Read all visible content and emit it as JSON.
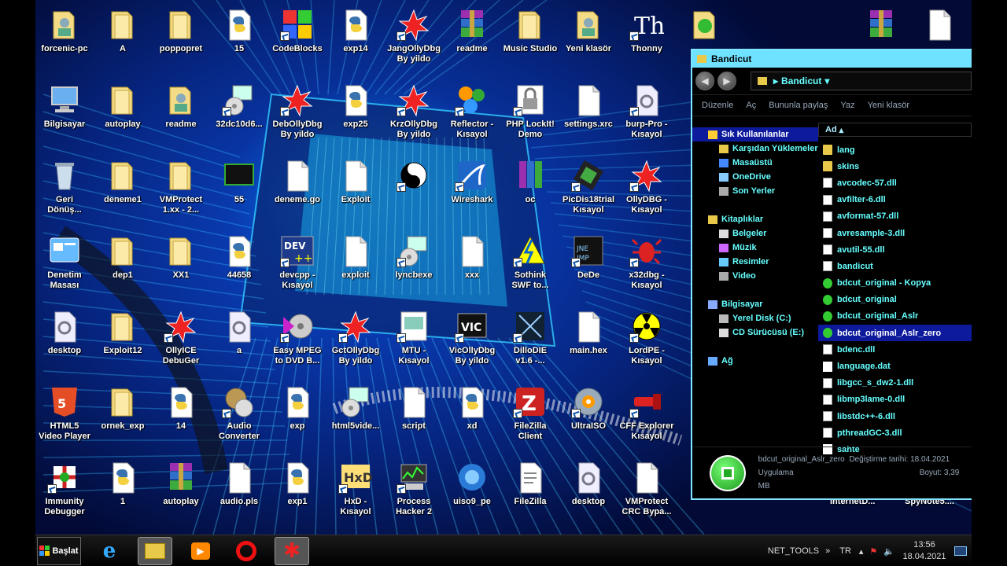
{
  "desktop": {
    "icons": [
      {
        "label": "forcenic-pc",
        "type": "user-folder",
        "col": 0,
        "row": 0,
        "shortcut": false
      },
      {
        "label": "A",
        "type": "folder",
        "col": 1,
        "row": 0,
        "shortcut": false
      },
      {
        "label": "poppopret",
        "type": "folder",
        "col": 2,
        "row": 0,
        "shortcut": false
      },
      {
        "label": "15",
        "type": "python",
        "col": 3,
        "row": 0,
        "shortcut": false
      },
      {
        "label": "CodeBlocks",
        "type": "codeblocks",
        "col": 4,
        "row": 0,
        "shortcut": true
      },
      {
        "label": "exp14",
        "type": "python",
        "col": 5,
        "row": 0,
        "shortcut": false
      },
      {
        "label": "JangOllyDbg\nBy yildo",
        "type": "olly",
        "col": 6,
        "row": 0,
        "shortcut": true
      },
      {
        "label": "readme",
        "type": "winrar",
        "col": 7,
        "row": 0,
        "shortcut": false
      },
      {
        "label": "Music Studio",
        "type": "folder",
        "col": 8,
        "row": 0,
        "shortcut": false
      },
      {
        "label": "Yeni klasör",
        "type": "user-folder",
        "col": 9,
        "row": 0,
        "shortcut": false
      },
      {
        "label": "Thonny",
        "type": "thonny",
        "col": 10,
        "row": 0,
        "shortcut": true
      },
      {
        "label": "",
        "type": "folder-green",
        "col": 11,
        "row": 0,
        "shortcut": false
      },
      {
        "label": "Bilgisayar",
        "type": "computer",
        "col": 0,
        "row": 1,
        "shortcut": false
      },
      {
        "label": "autoplay",
        "type": "folder",
        "col": 1,
        "row": 1,
        "shortcut": false
      },
      {
        "label": "readme",
        "type": "user-folder",
        "col": 2,
        "row": 1,
        "shortcut": false
      },
      {
        "label": "32dc10d6...",
        "type": "installer",
        "col": 3,
        "row": 1,
        "shortcut": true
      },
      {
        "label": "DebOllyDbg\nBy yildo",
        "type": "olly",
        "col": 4,
        "row": 1,
        "shortcut": true
      },
      {
        "label": "exp25",
        "type": "python",
        "col": 5,
        "row": 1,
        "shortcut": false
      },
      {
        "label": "KrzOllyDbg\nBy yildo",
        "type": "olly",
        "col": 6,
        "row": 1,
        "shortcut": true
      },
      {
        "label": "Reflector -\nKısayol",
        "type": "reflector",
        "col": 7,
        "row": 1,
        "shortcut": true
      },
      {
        "label": "PHP LockIt!\nDemo",
        "type": "lock",
        "col": 8,
        "row": 1,
        "shortcut": true
      },
      {
        "label": "settings.xrc",
        "type": "blank",
        "col": 9,
        "row": 1,
        "shortcut": false
      },
      {
        "label": "burp-Pro -\nKısayol",
        "type": "gear-doc",
        "col": 10,
        "row": 1,
        "shortcut": true
      },
      {
        "label": "Geri\nDönüş...",
        "type": "recycle",
        "col": 0,
        "row": 2,
        "shortcut": false
      },
      {
        "label": "deneme1",
        "type": "folder",
        "col": 1,
        "row": 2,
        "shortcut": false
      },
      {
        "label": "VMProtect\n1.xx - 2...",
        "type": "folder",
        "col": 2,
        "row": 2,
        "shortcut": false
      },
      {
        "label": "55",
        "type": "terminal",
        "col": 3,
        "row": 2,
        "shortcut": false
      },
      {
        "label": "deneme.go",
        "type": "blank",
        "col": 4,
        "row": 2,
        "shortcut": false
      },
      {
        "label": "Exploit",
        "type": "blank",
        "col": 5,
        "row": 2,
        "shortcut": false
      },
      {
        "label": "",
        "type": "yinyang",
        "col": 6,
        "row": 2,
        "shortcut": true
      },
      {
        "label": "Wireshark",
        "type": "wireshark",
        "col": 7,
        "row": 2,
        "shortcut": true
      },
      {
        "label": "oc",
        "type": "winrar-books",
        "col": 8,
        "row": 2,
        "shortcut": false
      },
      {
        "label": "PicDis18trial\nKısayol",
        "type": "chip",
        "col": 9,
        "row": 2,
        "shortcut": true
      },
      {
        "label": "OllyDBG -\nKısayol",
        "type": "olly",
        "col": 10,
        "row": 2,
        "shortcut": true
      },
      {
        "label": "Denetim\nMasası",
        "type": "control",
        "col": 0,
        "row": 3,
        "shortcut": false
      },
      {
        "label": "dep1",
        "type": "folder",
        "col": 1,
        "row": 3,
        "shortcut": false
      },
      {
        "label": "XX1",
        "type": "folder",
        "col": 2,
        "row": 3,
        "shortcut": false
      },
      {
        "label": "44658",
        "type": "python",
        "col": 3,
        "row": 3,
        "shortcut": false
      },
      {
        "label": "devcpp -\nKısayol",
        "type": "dev",
        "col": 4,
        "row": 3,
        "shortcut": true
      },
      {
        "label": "exploit",
        "type": "blank",
        "col": 5,
        "row": 3,
        "shortcut": false
      },
      {
        "label": "lyncbexe",
        "type": "installer",
        "col": 6,
        "row": 3,
        "shortcut": true
      },
      {
        "label": "xxx",
        "type": "blank",
        "col": 7,
        "row": 3,
        "shortcut": false
      },
      {
        "label": "Sothink\nSWF to...",
        "type": "sothink",
        "col": 8,
        "row": 3,
        "shortcut": true
      },
      {
        "label": "DeDe",
        "type": "dede",
        "col": 9,
        "row": 3,
        "shortcut": true
      },
      {
        "label": "x32dbg -\nKısayol",
        "type": "bug",
        "col": 10,
        "row": 3,
        "shortcut": true
      },
      {
        "label": "desktop",
        "type": "gear-doc",
        "col": 0,
        "row": 4,
        "shortcut": false
      },
      {
        "label": "Exploit12",
        "type": "folder",
        "col": 1,
        "row": 4,
        "shortcut": false
      },
      {
        "label": "OllyICE\nDebuGer",
        "type": "olly",
        "col": 2,
        "row": 4,
        "shortcut": true
      },
      {
        "label": "a",
        "type": "gear-doc",
        "col": 3,
        "row": 4,
        "shortcut": false
      },
      {
        "label": "Easy MPEG\nto DVD B...",
        "type": "disc",
        "col": 4,
        "row": 4,
        "shortcut": true
      },
      {
        "label": "GctOllyDbg\nBy yildo",
        "type": "olly",
        "col": 5,
        "row": 4,
        "shortcut": true
      },
      {
        "label": "MTU -\nKısayol",
        "type": "monitor-doc",
        "col": 6,
        "row": 4,
        "shortcut": true
      },
      {
        "label": "VicOllyDbg\nBy yildo",
        "type": "vic",
        "col": 7,
        "row": 4,
        "shortcut": true
      },
      {
        "label": "DilloDIE\nv1.6 -...",
        "type": "dillo",
        "col": 8,
        "row": 4,
        "shortcut": true
      },
      {
        "label": "main.hex",
        "type": "blank",
        "col": 9,
        "row": 4,
        "shortcut": false
      },
      {
        "label": "LordPE -\nKısayol",
        "type": "radiation",
        "col": 10,
        "row": 4,
        "shortcut": true
      },
      {
        "label": "HTML5\nVideo Player",
        "type": "html5",
        "col": 0,
        "row": 5,
        "shortcut": false
      },
      {
        "label": "ornek_exp",
        "type": "folder",
        "col": 1,
        "row": 5,
        "shortcut": false
      },
      {
        "label": "14",
        "type": "python",
        "col": 2,
        "row": 5,
        "shortcut": false
      },
      {
        "label": "Audio\nConverter",
        "type": "audio",
        "col": 3,
        "row": 5,
        "shortcut": true
      },
      {
        "label": "exp",
        "type": "python",
        "col": 4,
        "row": 5,
        "shortcut": false
      },
      {
        "label": "html5vide...",
        "type": "installer",
        "col": 5,
        "row": 5,
        "shortcut": false
      },
      {
        "label": "script",
        "type": "blank",
        "col": 6,
        "row": 5,
        "shortcut": false
      },
      {
        "label": "xd",
        "type": "python",
        "col": 7,
        "row": 5,
        "shortcut": false
      },
      {
        "label": "FileZilla\nClient",
        "type": "filezilla",
        "col": 8,
        "row": 5,
        "shortcut": true
      },
      {
        "label": "UltraISO",
        "type": "ultraiso",
        "col": 9,
        "row": 5,
        "shortcut": true
      },
      {
        "label": "CFF Explorer\nKısayol",
        "type": "cff",
        "col": 10,
        "row": 5,
        "shortcut": true
      },
      {
        "label": "Immunity\nDebugger",
        "type": "immunity",
        "col": 0,
        "row": 6,
        "shortcut": true
      },
      {
        "label": "1",
        "type": "python",
        "col": 1,
        "row": 6,
        "shortcut": false
      },
      {
        "label": "autoplay",
        "type": "winrar",
        "col": 2,
        "row": 6,
        "shortcut": false
      },
      {
        "label": "audio.pls",
        "type": "blank",
        "col": 3,
        "row": 6,
        "shortcut": false
      },
      {
        "label": "exp1",
        "type": "python",
        "col": 4,
        "row": 6,
        "shortcut": false
      },
      {
        "label": "HxD -\nKısayol",
        "type": "hxd",
        "col": 5,
        "row": 6,
        "shortcut": true
      },
      {
        "label": "Process\nHacker 2",
        "type": "process",
        "col": 6,
        "row": 6,
        "shortcut": true
      },
      {
        "label": "uiso9_pe",
        "type": "ultraiso-globe",
        "col": 7,
        "row": 6,
        "shortcut": false
      },
      {
        "label": "FileZilla",
        "type": "text-doc",
        "col": 8,
        "row": 6,
        "shortcut": false
      },
      {
        "label": "desktop",
        "type": "gear-doc",
        "col": 9,
        "row": 6,
        "shortcut": false
      },
      {
        "label": "VMProtect\nCRC Bypa...",
        "type": "blank",
        "col": 10,
        "row": 6,
        "shortcut": false
      }
    ],
    "top_right_icons": [
      {
        "label": "",
        "type": "winrar"
      },
      {
        "label": "",
        "type": "blank"
      }
    ],
    "behind_window_labels": [
      "InternetD...",
      "SpyNote5...."
    ]
  },
  "explorer": {
    "title": "Bandicut",
    "address": "Bandicut",
    "commands": [
      "Düzenle",
      "Aç",
      "Bununla paylaş",
      "Yaz",
      "Yeni klasör"
    ],
    "nav": [
      {
        "label": "Sık Kullanılanlar",
        "level": 0,
        "selected": true,
        "icon": "star-icon"
      },
      {
        "label": "Karşıdan Yüklemeler",
        "level": 1,
        "icon": "folder-icon"
      },
      {
        "label": "Masaüstü",
        "level": 1,
        "icon": "desktop-icon"
      },
      {
        "label": "OneDrive",
        "level": 1,
        "icon": "cloud-icon"
      },
      {
        "label": "Son Yerler",
        "level": 1,
        "icon": "recent-icon"
      },
      {
        "label": "",
        "level": -1
      },
      {
        "label": "Kitaplıklar",
        "level": 0,
        "icon": "library-icon"
      },
      {
        "label": "Belgeler",
        "level": 1,
        "icon": "document-icon"
      },
      {
        "label": "Müzik",
        "level": 1,
        "icon": "music-icon"
      },
      {
        "label": "Resimler",
        "level": 1,
        "icon": "picture-icon"
      },
      {
        "label": "Video",
        "level": 1,
        "icon": "video-icon"
      },
      {
        "label": "",
        "level": -1
      },
      {
        "label": "Bilgisayar",
        "level": 0,
        "icon": "computer-icon"
      },
      {
        "label": "Yerel Disk (C:)",
        "level": 1,
        "icon": "disk-icon"
      },
      {
        "label": "CD Sürücüsü (E:)",
        "level": 1,
        "icon": "cd-icon"
      },
      {
        "label": "",
        "level": -1
      },
      {
        "label": "Ağ",
        "level": 0,
        "icon": "network-icon"
      }
    ],
    "column_header": "Ad",
    "files": [
      {
        "name": "lang",
        "kind": "folder"
      },
      {
        "name": "skins",
        "kind": "folder"
      },
      {
        "name": "avcodec-57.dll",
        "kind": "dll"
      },
      {
        "name": "avfilter-6.dll",
        "kind": "dll"
      },
      {
        "name": "avformat-57.dll",
        "kind": "dll"
      },
      {
        "name": "avresample-3.dll",
        "kind": "dll"
      },
      {
        "name": "avutil-55.dll",
        "kind": "dll"
      },
      {
        "name": "bandicut",
        "kind": "dll"
      },
      {
        "name": "bdcut_original - Kopya",
        "kind": "exe"
      },
      {
        "name": "bdcut_original",
        "kind": "exe"
      },
      {
        "name": "bdcut_original_Aslr",
        "kind": "exe"
      },
      {
        "name": "bdcut_original_Aslr_zero",
        "kind": "exe",
        "selected": true
      },
      {
        "name": "bdenc.dll",
        "kind": "dll"
      },
      {
        "name": "language.dat",
        "kind": "blank"
      },
      {
        "name": "libgcc_s_dw2-1.dll",
        "kind": "dll"
      },
      {
        "name": "libmp3lame-0.dll",
        "kind": "dll"
      },
      {
        "name": "libstdc++-6.dll",
        "kind": "dll"
      },
      {
        "name": "pthreadGC-3.dll",
        "kind": "dll"
      },
      {
        "name": "sahte",
        "kind": "blank"
      }
    ],
    "details": {
      "name": "bdcut_original_Aslr_zero",
      "type": "Uygulama",
      "modified_label": "Değiştirme tarihi:",
      "modified": "18.04.2021",
      "size_label": "Boyut:",
      "size": "3,39 MB"
    }
  },
  "taskbar": {
    "start": "Başlat",
    "apps": [
      "ie-icon",
      "explorer-icon",
      "media-player-icon",
      "opera-icon",
      "ollydbg-icon"
    ],
    "active_index": 1,
    "tray_label": "NET_TOOLS",
    "lang": "TR",
    "time": "13:56",
    "date": "18.04.2021"
  }
}
